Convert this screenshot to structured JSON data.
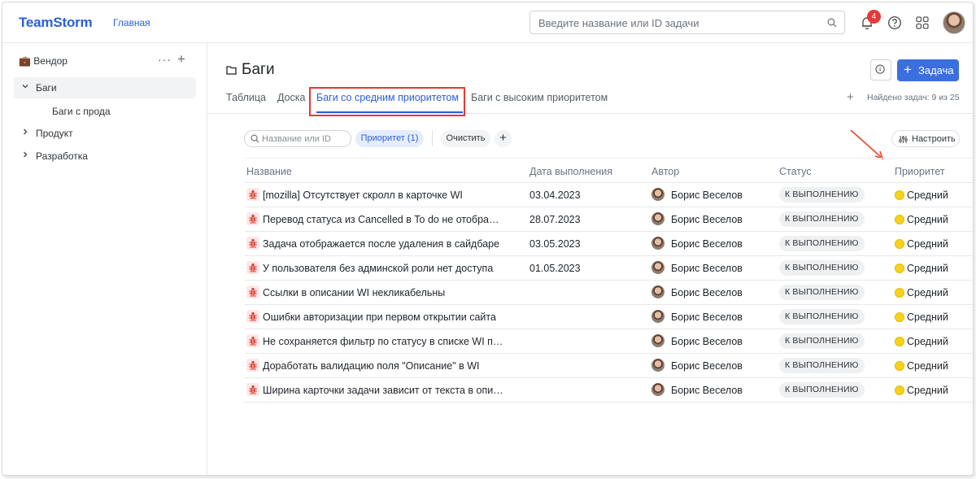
{
  "header": {
    "logo": "TeamStorm",
    "nav_home": "Главная",
    "search_placeholder": "Введите название или ID задачи",
    "notifications_count": "4"
  },
  "sidebar": {
    "workspace": "💼 Вендор",
    "items": [
      {
        "label": "Баги",
        "expanded": true,
        "active": true
      },
      {
        "label": "Баги с прода",
        "sub": true
      },
      {
        "label": "Продукт",
        "expanded": false
      },
      {
        "label": "Разработка",
        "expanded": false
      }
    ]
  },
  "page": {
    "title": "Баги",
    "new_task_label": "Задача",
    "tabs": [
      "Таблица",
      "Доска",
      "Баги со средним приоритетом",
      "Баги с высоким приоритетом"
    ],
    "active_tab": "Баги со средним приоритетом",
    "found": "Найдено задач: 9 из 25"
  },
  "filters": {
    "search_placeholder": "Название или ID",
    "priority_chip": "Приоритет (1)",
    "clear": "Очистить",
    "configure": "Настроить"
  },
  "table": {
    "columns": [
      "Название",
      "Дата выполнения",
      "Автор",
      "Статус",
      "Приоритет"
    ],
    "rows": [
      {
        "name": "[mozilla] Отсутствует скролл в карточке WI",
        "date": "03.04.2023",
        "author": "Борис Веселов",
        "status": "К ВЫПОЛНЕНИЮ",
        "priority": "Средний"
      },
      {
        "name": "Перевод статуса из Cancelled в To do не отображается",
        "date": "28.07.2023",
        "author": "Борис Веселов",
        "status": "К ВЫПОЛНЕНИЮ",
        "priority": "Средний"
      },
      {
        "name": "Задача отображается после удаления в сайдбаре",
        "date": "03.05.2023",
        "author": "Борис Веселов",
        "status": "К ВЫПОЛНЕНИЮ",
        "priority": "Средний"
      },
      {
        "name": "У пользователя без админской роли нет доступа",
        "date": "01.05.2023",
        "author": "Борис Веселов",
        "status": "К ВЫПОЛНЕНИЮ",
        "priority": "Средний"
      },
      {
        "name": "Ссылки в описании WI некликабельны",
        "date": "",
        "author": "Борис Веселов",
        "status": "К ВЫПОЛНЕНИЮ",
        "priority": "Средний"
      },
      {
        "name": "Ошибки авторизации при первом открытии сайта",
        "date": "",
        "author": "Борис Веселов",
        "status": "К ВЫПОЛНЕНИЮ",
        "priority": "Средний"
      },
      {
        "name": "Не сохраняется фильтр по статусу в списке WI после перезагрузки",
        "date": "",
        "author": "Борис Веселов",
        "status": "К ВЫПОЛНЕНИЮ",
        "priority": "Средний"
      },
      {
        "name": "Доработать валидацию поля \"Описание\" в WI",
        "date": "",
        "author": "Борис Веселов",
        "status": "К ВЫПОЛНЕНИЮ",
        "priority": "Средний"
      },
      {
        "name": "Ширина карточки задачи зависит от текста в описании",
        "date": "",
        "author": "Борис Веселов",
        "status": "К ВЫПОЛНЕНИЮ",
        "priority": "Средний"
      }
    ]
  },
  "colors": {
    "accent": "#2b5fd9",
    "primary_button": "#3b6fe0",
    "highlight": "#e53935",
    "priority_medium": "#f7d21d"
  },
  "icons": [
    "search-icon",
    "bell-icon",
    "help-icon",
    "apps-grid-icon",
    "folder-icon",
    "info-icon",
    "bug-icon",
    "settings-sliders-icon",
    "chevron-down-icon",
    "chevron-right-icon"
  ]
}
